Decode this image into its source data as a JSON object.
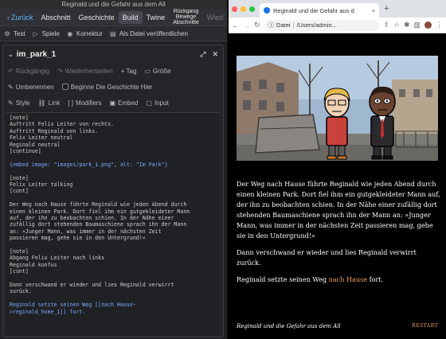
{
  "twine": {
    "window_title": "Reginald und die Gefahr aus dem All",
    "menu": {
      "back": "Zurück",
      "items": [
        "Abschnitt",
        "Geschichte",
        "Build",
        "Twine"
      ],
      "active": "Build",
      "trace": "Rückgang Bewege Abschnitte",
      "more": "Wied"
    },
    "toolbar": {
      "test": "Test",
      "play": "Spiele",
      "proof": "Korrektur",
      "publish": "Als Datei veröffentlichen"
    },
    "dialog": {
      "passage_name": "im_park_1",
      "undo": "Rückgängig",
      "redo": "Wiederherstellen",
      "tag": "+ Tag",
      "size": "Größe",
      "rename": "Umbenennen",
      "start_here": "Beginne Die Geschichte Hier",
      "format": {
        "style": "Style",
        "link": "Link",
        "modifiers": "Modifiers",
        "embed": "Embed",
        "input": "Input"
      }
    },
    "source_lines": [
      "[note]",
      "Auftritt Felix Leiter von rechts.",
      "Auftritt Reginald von links.",
      "Felix Leiter neutral",
      "Reginald neutral",
      "[continue]",
      "",
      "{embed image: \"images/park_1.png\", alt: \"Im Park\"}",
      "",
      "[note]",
      "Felix Leiter talking",
      "[cont]",
      "",
      "Der Weg nach Hause führte Reginald wie jeden Abend durch",
      "einen kleinen Park. Dort fiel ihm ein gutgekleideter Mann",
      "auf, der ihn zu beobachten schien. In der Nähe einer",
      "zufällig dort stehenden Baumaschiene sprach ihn der Mann",
      "an: »Junger Mann, was immer in der nächsten Zeit",
      "passieren mag, gehe sie in den Untergrund!«",
      "",
      "[note]",
      "Abgang Felix Leiter nach links",
      "Reginald konfus",
      "[cont]",
      "",
      "Dann verschwand er wieder und lies Reginald verwirrt",
      "zurück.",
      "",
      "Reginald setzte seinen Weg [[nach Hause-",
      ">reginald_home_1]] fort."
    ]
  },
  "browser": {
    "tab_title": "Reginald und die Gefahr aus d",
    "address_label": "Datei",
    "address_path": "/Users/admin...",
    "new_tab": "+"
  },
  "story": {
    "paragraph_1": "Der Weg nach Hause führte Reginald wie jeden Abend durch einen kleinen Park. Dort fiel ihm ein gutgekleideter Mann auf, der ihn zu beobachten schien. In der Nähe einer zufällig dort stehenden Baumaschiene sprach ihn der Mann an: »Junger Mann, was immer in der nächsten Zeit passieren mag, gehe sie in den Untergrund!«",
    "paragraph_2": "Dann verschwand er wieder und lies Reginald verwirrt zurück.",
    "paragraph_3_before": "Reginald setzte seinen Weg ",
    "link_text": "nach Hause",
    "paragraph_3_after": " fort.",
    "footer_title": "Reginald und die Gefahr aus dem All",
    "restart": "RESTART"
  },
  "colors": {
    "link": "#f3a35c",
    "code_link": "#7aa7ff",
    "traffic_red": "#ff5f57",
    "traffic_yellow": "#febc2e",
    "traffic_green": "#28c840"
  }
}
